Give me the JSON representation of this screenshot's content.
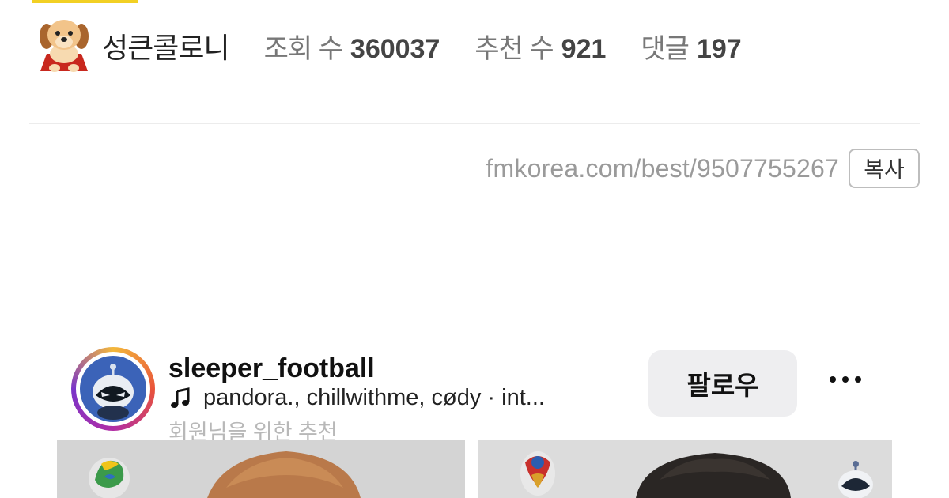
{
  "author": {
    "avatar_icon": "puppy-avatar-icon",
    "name": "성큰콜로니"
  },
  "stats": {
    "views_label": "조회 수",
    "views_value": "360037",
    "upvotes_label": "추천 수",
    "upvotes_value": "921",
    "comments_label": "댓글",
    "comments_value": "197"
  },
  "url": {
    "text": "fmkorea.com/best/9507755267",
    "copy_label": "복사"
  },
  "post": {
    "username": "sleeper_football",
    "music_icon": "music-note-icon",
    "music_text": "pandora., chillwithme, cødy · int...",
    "suggestion": "회원님을 위한 추천",
    "follow_label": "팔로우",
    "more_icon": "more-horizontal-icon"
  },
  "colors": {
    "accent_yellow": "#f2d024",
    "ring_gradient": [
      "#f3b83b",
      "#e9533a",
      "#b12da5",
      "#7a35c9"
    ]
  }
}
